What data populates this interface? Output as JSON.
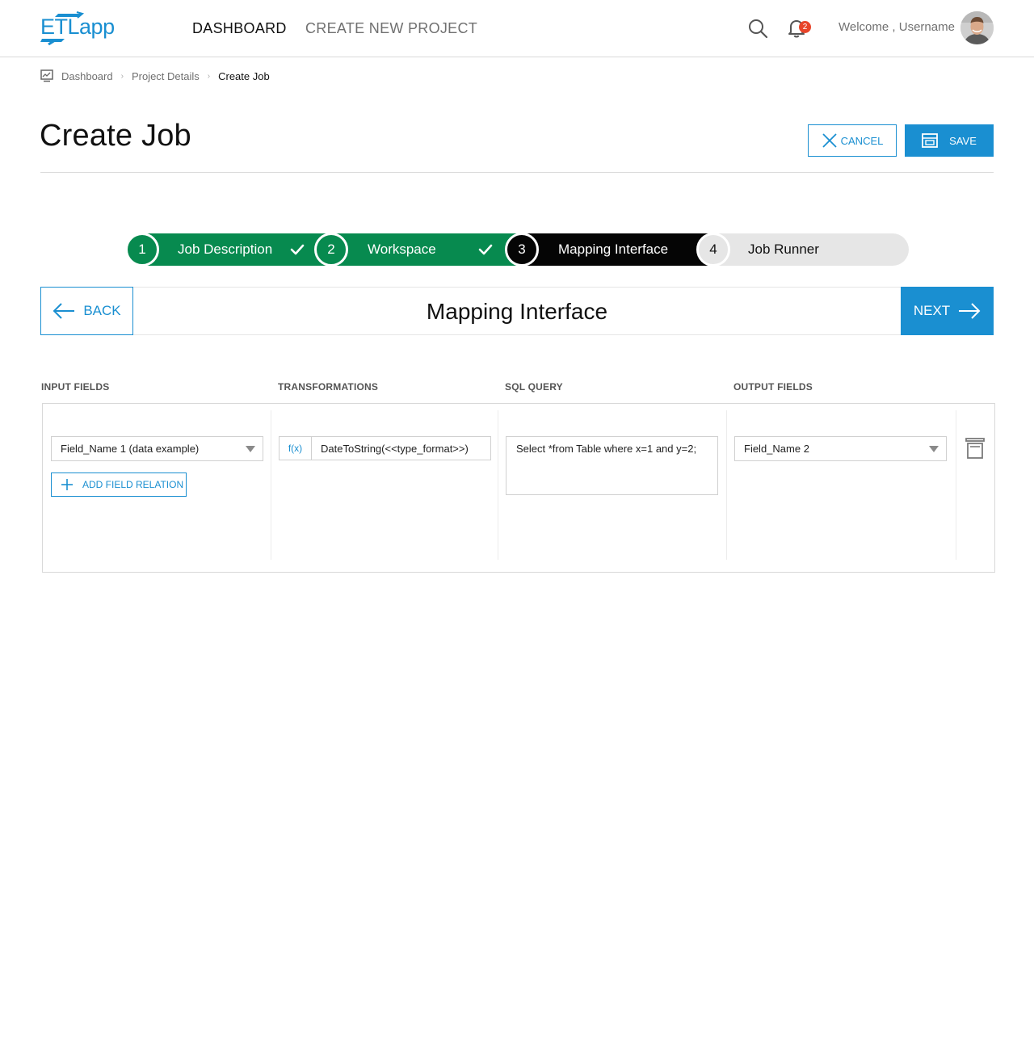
{
  "header": {
    "logo": {
      "brand_main": "ETL",
      "brand_sub": "app"
    },
    "nav": [
      {
        "label": "DASHBOARD",
        "active": true
      },
      {
        "label": "CREATE NEW PROJECT",
        "active": false
      }
    ],
    "notifications": {
      "count": "2",
      "icon": "bell-icon"
    },
    "welcome_text": "Welcome , Username",
    "search_icon": "search-icon",
    "accent_color": "#1a8fd1"
  },
  "breadcrumb": {
    "icon": "dashboard-icon",
    "items": [
      "Dashboard",
      "Project Details",
      "Create Job"
    ]
  },
  "page": {
    "title": "Create Job",
    "cancel_label": "CANCEL",
    "save_label": "SAVE"
  },
  "stepper": {
    "completed_color": "#078a4f",
    "active_color": "#050505",
    "pending_color": "#e6e6e6",
    "steps": [
      {
        "number": "1",
        "label": "Job Description",
        "status": "completed"
      },
      {
        "number": "2",
        "label": "Workspace",
        "status": "completed"
      },
      {
        "number": "3",
        "label": "Mapping Interface",
        "status": "active"
      },
      {
        "number": "4",
        "label": "Job Runner",
        "status": "pending"
      }
    ]
  },
  "section": {
    "back_label": "BACK",
    "title": "Mapping Interface",
    "next_label": "NEXT"
  },
  "mapping": {
    "columns": {
      "input": "INPUT FIELDS",
      "transformations": "TRANSFORMATIONS",
      "sql": "SQL QUERY",
      "output": "OUTPUT FIELDS"
    },
    "input_field_value": "Field_Name 1 (data example)",
    "add_relation_label": "ADD FIELD RELATION",
    "transformation": {
      "tag": "f(x)",
      "value": "DateToString(<<type_format>>)"
    },
    "sql_query": "Select *from Table where x=1 and y=2;",
    "output_field_value": "Field_Name 2",
    "delete_icon": "trash-icon"
  }
}
